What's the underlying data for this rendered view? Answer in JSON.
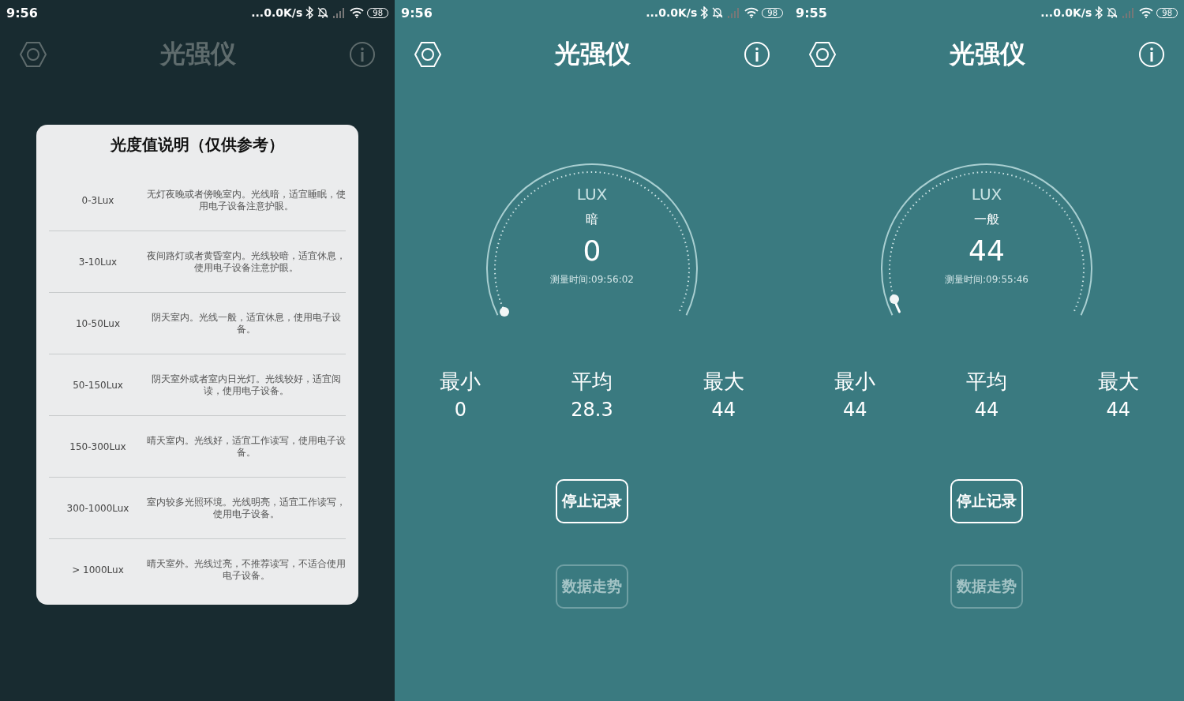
{
  "screens": [
    {
      "kind": "dialog",
      "status_bar": {
        "time": "9:56",
        "speed": "...0.0K/s",
        "battery": "98"
      },
      "header": {
        "title": "光强仪"
      },
      "dialog": {
        "title": "光度值说明（仅供参考）",
        "rows": [
          {
            "range": "0-3Lux",
            "description": "无灯夜晚或者傍晚室内。光线暗，适宜睡眠，使用电子设备注意护眼。"
          },
          {
            "range": "3-10Lux",
            "description": "夜间路灯或者黄昏室内。光线较暗，适宜休息，使用电子设备注意护眼。"
          },
          {
            "range": "10-50Lux",
            "description": "阴天室内。光线一般，适宜休息，使用电子设备。"
          },
          {
            "range": "50-150Lux",
            "description": "阴天室外或者室内日光灯。光线较好，适宜阅读，使用电子设备。"
          },
          {
            "range": "150-300Lux",
            "description": "晴天室内。光线好，适宜工作读写，使用电子设备。"
          },
          {
            "range": "300-1000Lux",
            "description": "室内较多光照环境。光线明亮，适宜工作读写，使用电子设备。"
          },
          {
            "range": "> 1000Lux",
            "description": "晴天室外。光线过亮，不推荐读写，不适合使用电子设备。"
          }
        ]
      }
    },
    {
      "kind": "meter",
      "status_bar": {
        "time": "9:56",
        "speed": "...0.0K/s",
        "battery": "98"
      },
      "header": {
        "title": "光强仪"
      },
      "gauge": {
        "unit": "LUX",
        "rating": "暗",
        "value": "0",
        "time": "测量时间:09:56:02",
        "level": 0
      },
      "stats": [
        {
          "label": "最小",
          "value": "0"
        },
        {
          "label": "平均",
          "value": "28.3"
        },
        {
          "label": "最大",
          "value": "44"
        }
      ],
      "buttons": [
        {
          "label": "停止记录",
          "disabled": false
        },
        {
          "label": "数据走势",
          "disabled": true
        }
      ]
    },
    {
      "kind": "meter",
      "status_bar": {
        "time": "9:55",
        "speed": "...0.0K/s",
        "battery": "98"
      },
      "header": {
        "title": "光强仪"
      },
      "gauge": {
        "unit": "LUX",
        "rating": "一般",
        "value": "44",
        "time": "测量时间:09:55:46",
        "level": 0.035
      },
      "stats": [
        {
          "label": "最小",
          "value": "44"
        },
        {
          "label": "平均",
          "value": "44"
        },
        {
          "label": "最大",
          "value": "44"
        }
      ],
      "buttons": [
        {
          "label": "停止记录",
          "disabled": false
        },
        {
          "label": "数据走势",
          "disabled": true
        }
      ]
    }
  ]
}
